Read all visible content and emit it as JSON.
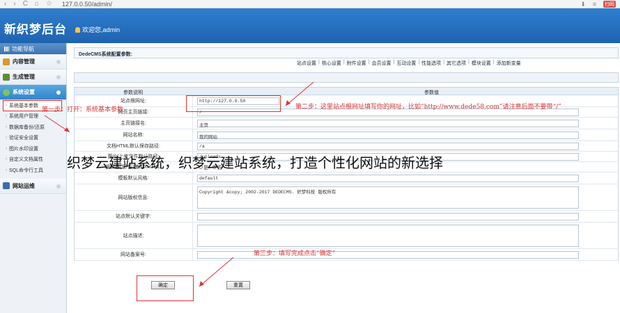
{
  "browser": {
    "back": "‹",
    "forward": "›",
    "reload": "C",
    "home": "⌂",
    "star": "☆",
    "url": "127.0.0.50/admin/",
    "ext_label": "扫码"
  },
  "header": {
    "logo": "新织梦后台",
    "welcome": "欢迎您,admin"
  },
  "sidebar": {
    "title": "功能导航",
    "groups": [
      {
        "label": "内容管理",
        "color": "#d89a2b"
      },
      {
        "label": "生成管理",
        "color": "#5a8f3a"
      },
      {
        "label": "系统设置",
        "color": "#4aa0e0"
      },
      {
        "label": "网站运维",
        "color": "#3a6db5"
      }
    ],
    "items": [
      "系统基本参数",
      "系统用户管理",
      "数据库备份/还原",
      "验证安全设置",
      "图片水印设置",
      "自定义文档属性",
      "SQL命令行工具"
    ]
  },
  "main": {
    "panel_title": "DedeCMS系统配置参数:",
    "tabs": [
      "站点设置",
      "核心设置",
      "附件设置",
      "会员设置",
      "互动设置",
      "性能选项",
      "其它选项",
      "模块设置",
      "添加新变量"
    ],
    "col_name": "参数说明",
    "col_value": "参数值",
    "rows": [
      {
        "label": "站点根网址:",
        "value": "http://127.0.0.50"
      },
      {
        "label": "网页主页链接:",
        "value": "/"
      },
      {
        "label": "主页链接名:",
        "value": "主页"
      },
      {
        "label": "网站名称:",
        "value": "我的网站"
      },
      {
        "label": "文档HTML默认保存路径:",
        "value": "/a"
      },
      {
        "label": "图片/上传文件默认路径:",
        "value": "/uploads"
      },
      {
        "label": "编辑器(是/否)使用XHTML:",
        "yes": "是",
        "no": "否"
      },
      {
        "label": "模板默认风格:",
        "value": "default"
      },
      {
        "label": "网站版权信息:",
        "value": "Copyright &copy; 2002-2017 DEDECMS. 织梦科技 版权所有"
      },
      {
        "label": "站点默认关键字:",
        "value": ""
      },
      {
        "label": "站点描述:",
        "value": ""
      },
      {
        "label": "网站备案号:",
        "value": ""
      }
    ],
    "confirm": "确定",
    "reset": "重置"
  },
  "annotations": {
    "step1": "第一步：打开：系统基本参数",
    "step2": "第二步：这里站点根网址填写你的网址，比如“http://www.dede58.com”请注意后面不要带“/”",
    "step3": "第三步：填写完成点击“确定”",
    "overlay": "织梦云建站系统，织梦云建站系统，打造个性化网站的新选择"
  }
}
